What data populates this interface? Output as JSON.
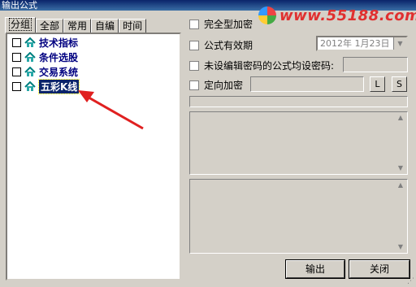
{
  "window": {
    "title": "输出公式"
  },
  "watermark": {
    "text": "www.55188.com"
  },
  "tabs": [
    {
      "label": "分组",
      "active": true
    },
    {
      "label": "全部"
    },
    {
      "label": "常用"
    },
    {
      "label": "自编"
    },
    {
      "label": "时间"
    }
  ],
  "tree": {
    "items": [
      {
        "label": "技术指标",
        "checked": false
      },
      {
        "label": "条件选股",
        "checked": false
      },
      {
        "label": "交易系统",
        "checked": false
      },
      {
        "label": "五彩K线",
        "checked": false,
        "selected": true
      }
    ]
  },
  "options": {
    "full_encrypt": "完全型加密",
    "expiry": "公式有效期",
    "expiry_date": "2012年 1月23日",
    "unset_password": "未设编辑密码的公式均设密码:",
    "directed_encrypt": "定向加密",
    "btn_l": "L",
    "btn_s": "S"
  },
  "buttons": {
    "export": "输出",
    "close": "关闭"
  },
  "colors": {
    "accent": "#0a246a",
    "arrow": "#e02020",
    "watermark": "#e03030"
  }
}
